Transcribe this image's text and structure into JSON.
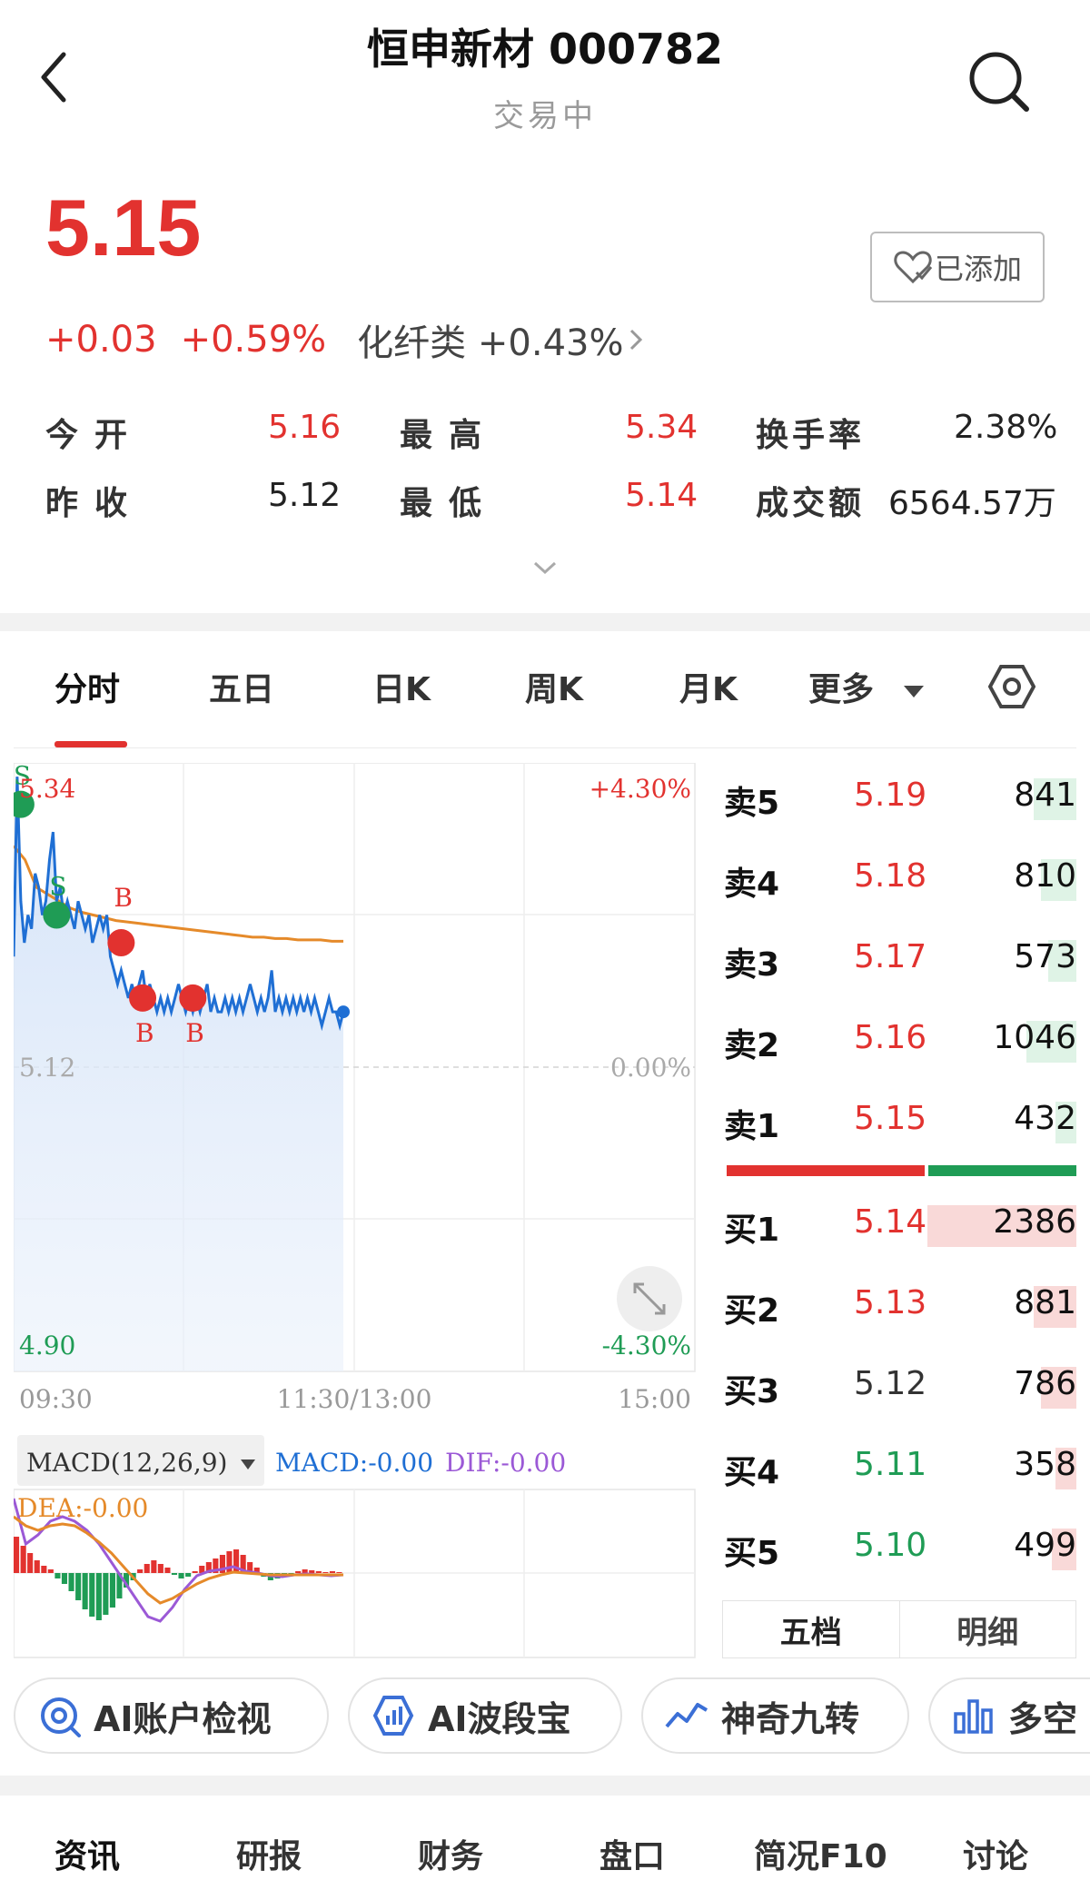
{
  "header": {
    "title": "恒申新材 000782",
    "status": "交易中"
  },
  "quote": {
    "price": "5.15",
    "change": "+0.03",
    "change_pct": "+0.59%",
    "sector_name": "化纤类",
    "sector_change": "+0.43%",
    "watchlist_label": "已添加",
    "stats": [
      {
        "label": "今开",
        "value": "5.16",
        "color": "#e2322f"
      },
      {
        "label": "昨收",
        "value": "5.12",
        "color": "#222222"
      },
      {
        "label": "最高",
        "value": "5.34",
        "color": "#e2322f"
      },
      {
        "label": "最低",
        "value": "5.14",
        "color": "#e2322f"
      },
      {
        "label": "换手率",
        "value": "2.38%",
        "color": "#222222"
      },
      {
        "label": "成交额",
        "value": "6564.57万",
        "color": "#222222"
      }
    ]
  },
  "tabs": [
    {
      "label": "分时",
      "active": true
    },
    {
      "label": "五日"
    },
    {
      "label": "日K"
    },
    {
      "label": "周K"
    },
    {
      "label": "月K"
    },
    {
      "label": "更多"
    }
  ],
  "chart": {
    "y_top": "5.34",
    "y_mid": "5.12",
    "y_bottom": "4.90",
    "pct_top": "+4.30%",
    "pct_mid": "0.00%",
    "pct_bottom": "-4.30%",
    "x_start": "09:30",
    "x_mid": "11:30/13:00",
    "x_end": "15:00",
    "signal_s": "S",
    "signal_b": "B",
    "macd_selector": "MACD(12,26,9)",
    "macd_value": "MACD:-0.00",
    "dif_value": "DIF:-0.00",
    "dea_value": "DEA:-0.00"
  },
  "chart_data": {
    "type": "line",
    "y_range": [
      4.9,
      5.34
    ],
    "x_range": [
      "09:30",
      "15:00"
    ],
    "base_price": 5.12,
    "series": [
      {
        "color": "#1f6fd4",
        "values": [
          5.2,
          5.33,
          5.24,
          5.21,
          5.23,
          5.22,
          5.26,
          5.25,
          5.23,
          5.24,
          5.27,
          5.29,
          5.24,
          5.25,
          5.23,
          5.24,
          5.23,
          5.22,
          5.24,
          5.23,
          5.22,
          5.23,
          5.21,
          5.22,
          5.23,
          5.22,
          5.23,
          5.2,
          5.19,
          5.18,
          5.19,
          5.18,
          5.17,
          5.18,
          5.17,
          5.18,
          5.19,
          5.17,
          5.18,
          5.17,
          5.16,
          5.17,
          5.16,
          5.17,
          5.16,
          5.17,
          5.18,
          5.17,
          5.16,
          5.17,
          5.16,
          5.17,
          5.16,
          5.17,
          5.18,
          5.16,
          5.17,
          5.16,
          5.16,
          5.17,
          5.16,
          5.17,
          5.16,
          5.17,
          5.16,
          5.17,
          5.18,
          5.17,
          5.16,
          5.17,
          5.16,
          5.17,
          5.19,
          5.16,
          5.17,
          5.16,
          5.17,
          5.16,
          5.17,
          5.16,
          5.17,
          5.16,
          5.17,
          5.16,
          5.17,
          5.16,
          5.15,
          5.16,
          5.17,
          5.16,
          5.16,
          5.15,
          5.16
        ]
      },
      {
        "color": "#e58a2a",
        "values": [
          5.28,
          5.27,
          5.25,
          5.245,
          5.24,
          5.235,
          5.232,
          5.23,
          5.228,
          5.226,
          5.225,
          5.224,
          5.223,
          5.222,
          5.221,
          5.22,
          5.219,
          5.218,
          5.217,
          5.216,
          5.215,
          5.214,
          5.214,
          5.213,
          5.213,
          5.212,
          5.212,
          5.212,
          5.211,
          5.211
        ]
      }
    ],
    "signals": [
      {
        "label": "S",
        "price": 5.31,
        "time_index": 2,
        "color": "#1f9c55"
      },
      {
        "label": "S",
        "price": 5.23,
        "time_index": 12,
        "color": "#1f9c55"
      },
      {
        "label": "B",
        "price": 5.21,
        "time_index": 30,
        "color": "#e2322f"
      },
      {
        "label": "B",
        "price": 5.17,
        "time_index": 36,
        "color": "#e2322f"
      },
      {
        "label": "B",
        "price": 5.17,
        "time_index": 50,
        "color": "#e2322f"
      }
    ]
  },
  "order_book": {
    "asks": [
      {
        "label": "卖5",
        "price": "5.19",
        "volume": "841",
        "color": "#e2322f",
        "bar": 0.12
      },
      {
        "label": "卖4",
        "price": "5.18",
        "volume": "810",
        "color": "#e2322f",
        "bar": 0.1
      },
      {
        "label": "卖3",
        "price": "5.17",
        "volume": "573",
        "color": "#e2322f",
        "bar": 0.08
      },
      {
        "label": "卖2",
        "price": "5.16",
        "volume": "1046",
        "color": "#e2322f",
        "bar": 0.14
      },
      {
        "label": "卖1",
        "price": "5.15",
        "volume": "432",
        "color": "#e2322f",
        "bar": 0.06
      }
    ],
    "bids": [
      {
        "label": "买1",
        "price": "5.14",
        "volume": "2386",
        "color": "#e2322f",
        "bar": 0.42
      },
      {
        "label": "买2",
        "price": "5.13",
        "volume": "881",
        "color": "#e2322f",
        "bar": 0.12
      },
      {
        "label": "买3",
        "price": "5.12",
        "volume": "786",
        "color": "#333333",
        "bar": 0.1
      },
      {
        "label": "买4",
        "price": "5.11",
        "volume": "358",
        "color": "#1f9c55",
        "bar": 0.06
      },
      {
        "label": "买5",
        "price": "5.10",
        "volume": "499",
        "color": "#1f9c55",
        "bar": 0.07
      }
    ],
    "tabs": [
      "五档",
      "明细"
    ]
  },
  "feature_pills": [
    {
      "label": "AI账户检视",
      "icon": "eye-scan-icon"
    },
    {
      "label": "AI波段宝",
      "icon": "ai-chart-icon"
    },
    {
      "label": "神奇九转",
      "icon": "trend-line-icon"
    },
    {
      "label": "多空",
      "icon": "bar-chart-icon"
    }
  ],
  "bottom_tabs": [
    "资讯",
    "研报",
    "财务",
    "盘口",
    "简况F10",
    "讨论"
  ],
  "colors": {
    "up": "#e2322f",
    "down": "#1f9c55",
    "line": "#1f6fd4",
    "avg": "#e58a2a"
  }
}
